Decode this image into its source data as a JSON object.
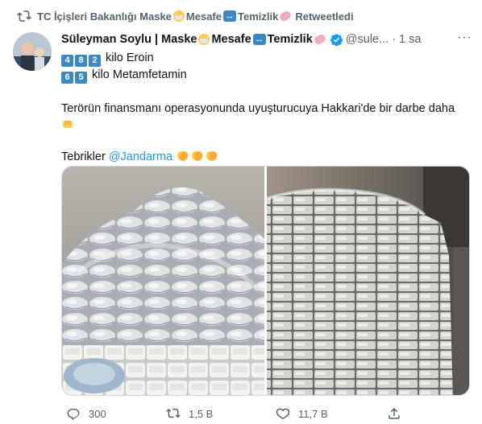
{
  "retweet_context": {
    "account_name": "TC İçişleri Bakanlığı Maske",
    "mid1": "Mesafe",
    "mid2": "Temizlik",
    "action": "Retweetledi"
  },
  "tweet": {
    "author_name": "Süleyman Soylu | Maske",
    "author_mid1": "Mesafe",
    "author_mid2": "Temizlik",
    "handle": "@sule...",
    "separator": "·",
    "time": "1 sa",
    "more_label": "···",
    "line1_digits": [
      "4",
      "8",
      "2"
    ],
    "line1_text": "kilo Eroin",
    "line2_digits": [
      "6",
      "5"
    ],
    "line2_text": "kilo Metamfetamin",
    "paragraph": "Terörün finansmanı operasyonunda uyuşturucuya Hakkari'de bir darbe daha",
    "congrats": "Tebrikler",
    "mention": "@Jandarma"
  },
  "actions": {
    "reply_count": "300",
    "retweet_count": "1,5 B",
    "like_count": "11,7 B"
  },
  "icons": {
    "retweet": "retweet-icon",
    "verified": "verified-badge-icon",
    "reply": "reply-icon",
    "like": "heart-icon",
    "share": "share-icon",
    "more": "more-icon"
  },
  "colors": {
    "accent": "#1d9bf0",
    "secondary_text": "#536471",
    "keycap": "#3b88c3"
  }
}
